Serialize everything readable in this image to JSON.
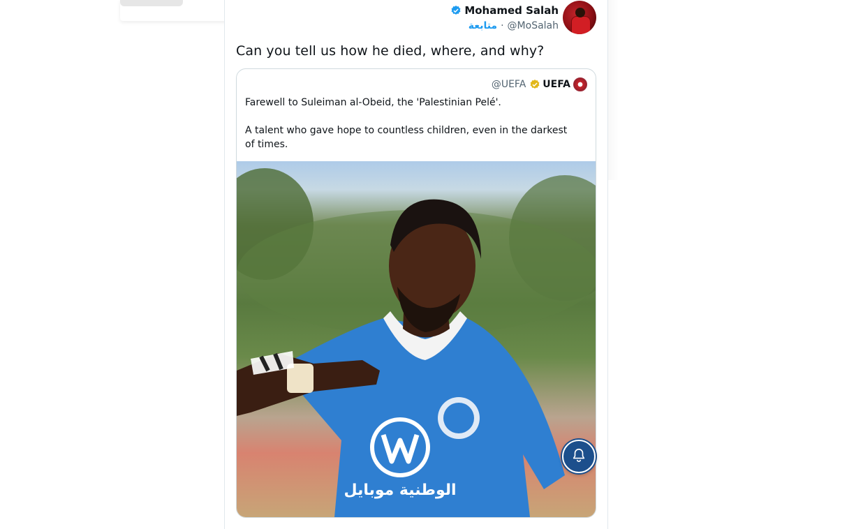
{
  "tweet": {
    "author_name": "Mohamed Salah",
    "author_handle": "@MoSalah",
    "follow_label": "متابعة",
    "separator": "·",
    "text": "Can you tell us how he died, where, and why?"
  },
  "quote": {
    "author_name": "UEFA",
    "author_handle": "@UEFA",
    "paragraphs": [
      "Farewell to Suleiman al-Obeid, the 'Palestinian Pelé'.",
      "A talent who gave hope to countless children, even in the darkest of times."
    ],
    "image_sponsor_text": "الوطنية موبايل"
  },
  "icons": {
    "verified": "verified-badge-icon",
    "org_badge": "gold-verified-badge-icon",
    "notification": "bell-icon"
  },
  "colors": {
    "accent": "#1d9bf0",
    "verified_gold": "#e2b719",
    "fab": "#1c4f8c"
  }
}
